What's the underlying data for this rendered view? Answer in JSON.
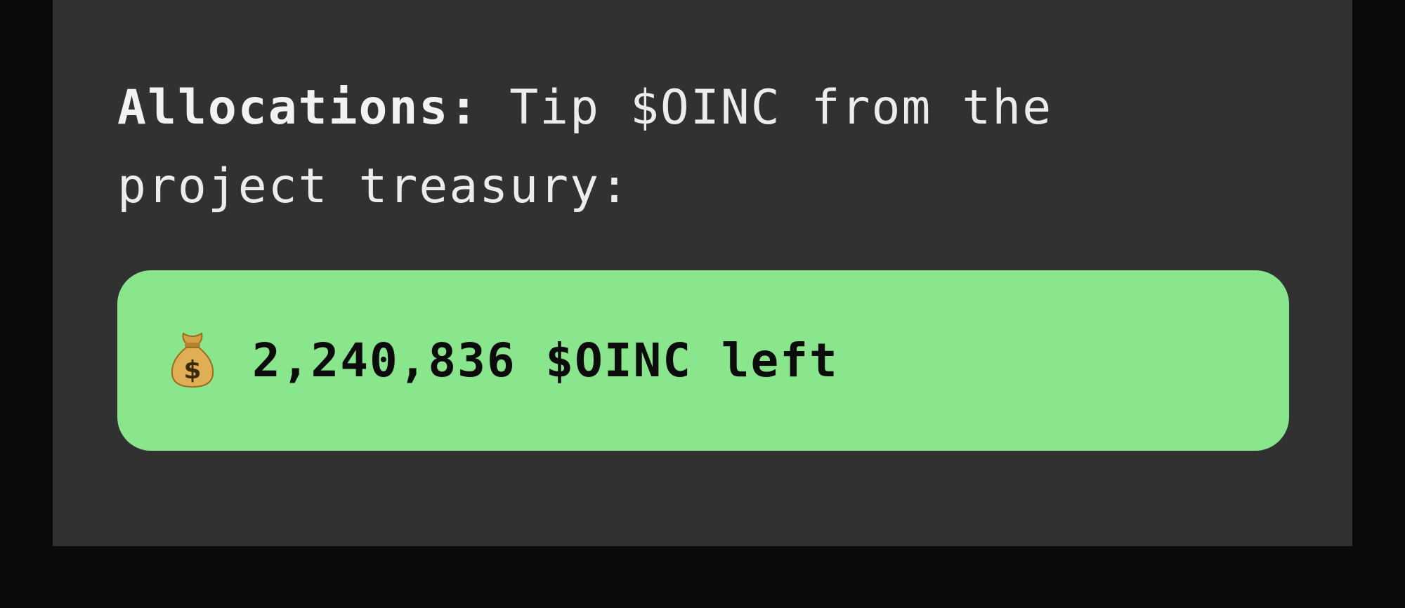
{
  "allocations": {
    "label": "Allocations:",
    "text": " Tip $OINC from the project treasury:"
  },
  "balance": {
    "icon": "money-bag-icon",
    "text": "2,240,836 $OINC left",
    "background": "#8ae68c"
  },
  "colors": {
    "page_background": "#0a0a0a",
    "card_background": "#313131",
    "text": "#ececec"
  }
}
